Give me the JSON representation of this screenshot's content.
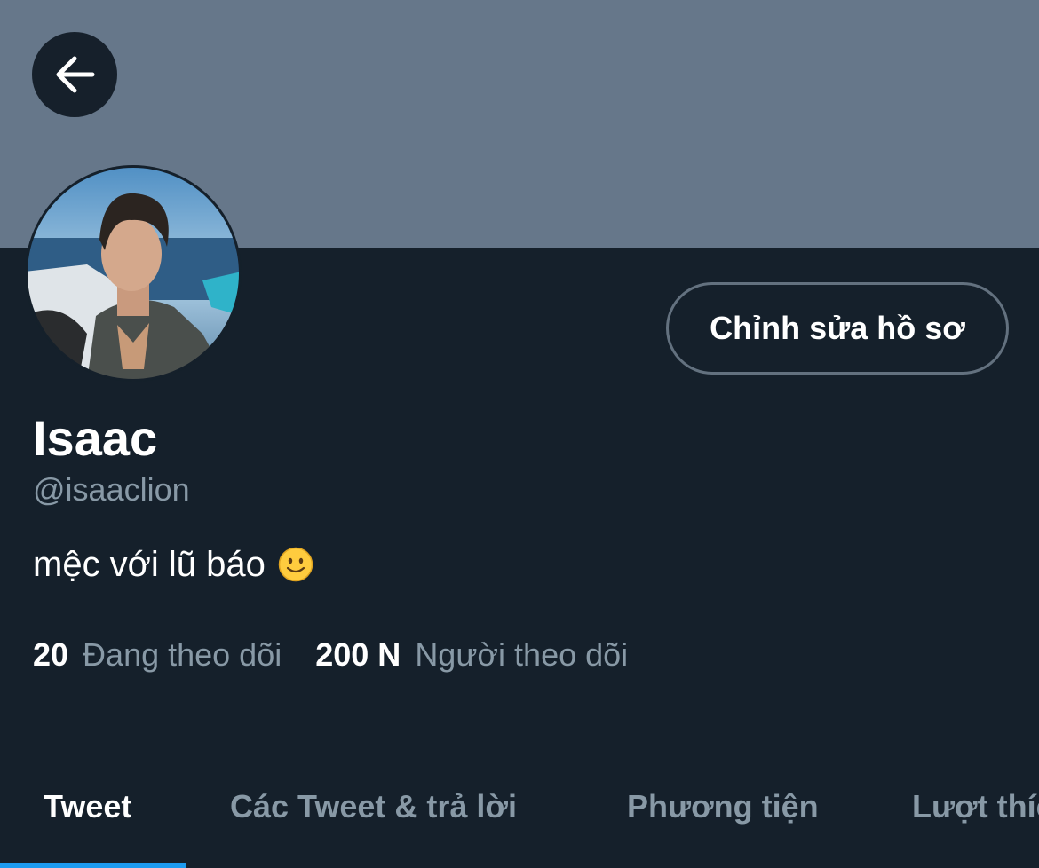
{
  "header": {
    "back_icon": "arrow-left-icon",
    "banner_color": "#66778a"
  },
  "profile": {
    "avatar_icon": "profile-photo",
    "edit_button_label": "Chỉnh sửa hồ sơ",
    "name": "Isaac",
    "handle": "@isaaclion",
    "bio": "mệc với lũ báo",
    "bio_emoji": "slightly-smiling-face-icon"
  },
  "stats": {
    "following_count": "20",
    "following_label": "Đang theo dõi",
    "followers_count": "200 N",
    "followers_label": "Người theo dõi"
  },
  "tabs": [
    {
      "label": "Tweet",
      "active": true
    },
    {
      "label": "Các Tweet & trả lời",
      "active": false
    },
    {
      "label": "Phương tiện",
      "active": false
    },
    {
      "label": "Lượt thích",
      "active": false
    }
  ],
  "colors": {
    "background": "#15202b",
    "accent": "#1d9bf0",
    "secondary_text": "#8899a6"
  }
}
